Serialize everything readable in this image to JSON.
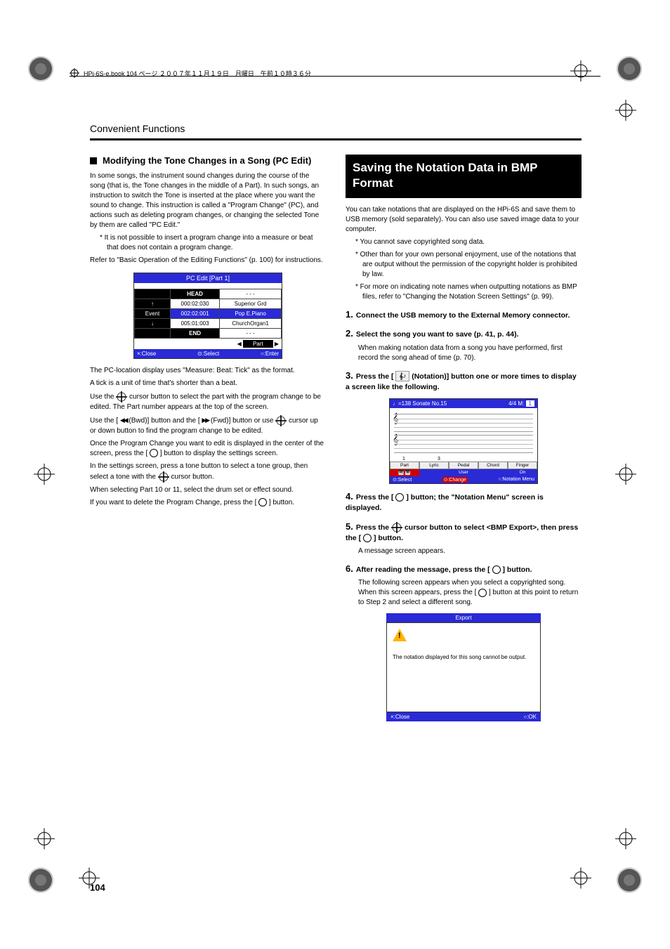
{
  "header_stamp": "HPi-6S-e.book  104 ページ  ２００７年１１月１９日　月曜日　午前１０時３６分",
  "running_head": "Convenient Functions",
  "left": {
    "title": "Modifying the Tone Changes in a Song (PC Edit)",
    "p1": "In some songs, the instrument sound changes during the course of the song (that is, the Tone changes in the middle of a Part). In such songs, an instruction to switch the Tone is inserted at the place where you want the sound to change. This instruction is called a \"Program Change\" (PC), and actions such as deleting program changes, or changing the selected Tone by them are called \"PC Edit.\"",
    "note1": "It is not possible to insert a program change into a measure or beat that does not contain a program change.",
    "p2": "Refer to \"Basic Operation of the Editing Functions\" (p. 100) for instructions.",
    "fig": {
      "title": "PC Edit [Part 1]",
      "head": "HEAD",
      "rows": [
        {
          "arrow": "↑",
          "loc": "000:02:030",
          "tone": "Superior Grd"
        },
        {
          "arrow": "Event",
          "loc": "002:02:001",
          "tone": "Pop E.Piano",
          "sel": true
        },
        {
          "arrow": "↓",
          "loc": "005:01:003",
          "tone": "ChurchOrgan1"
        }
      ],
      "end": "END",
      "partlabel": "Part",
      "close": "×:Close",
      "select": "⊙:Select",
      "enter": "○:Enter"
    },
    "p3": "The PC-location display uses \"Measure: Beat: Tick\" as the format.",
    "p4": "A tick is a unit of time that's shorter than a beat.",
    "p5a": "Use the ",
    "p5b": " cursor button to select the part with the program change to be edited. The Part number appears at the top of the screen.",
    "p6a": "Use the [ ",
    "p6b": " (Bwd)] button and the [ ",
    "p6c": " (Fwd)] button or use ",
    "p6d": " cursor up or down button to find the program change to be edited.",
    "p7": "Once the Program Change you want to edit is displayed in the center of the screen, press the [ ",
    "p7b": " ] button to display the settings screen.",
    "p8a": "In the settings screen, press a tone button to select a tone group, then select a tone with the ",
    "p8b": " cursor button.",
    "p9": "When selecting Part 10 or 11, select the drum set or effect sound.",
    "p10a": "If you want to delete the Program Change, press the [ ",
    "p10b": " ] button."
  },
  "right": {
    "heading": "Saving the Notation Data in BMP Format",
    "intro": "You can take notations that are displayed on the HPi-6S and save them to USB memory (sold separately). You can also use saved image data to your computer.",
    "bul1": "You cannot save copyrighted song data.",
    "bul2": "Other than for your own personal enjoyment, use of the notations that are output without the permission of the copyright holder is prohibited by law.",
    "bul3": "For more on indicating note names when outputting notations as BMP files, refer to \"Changing the Notation Screen Settings\" (p. 99).",
    "s1": "Connect the USB memory to the External Memory connector.",
    "s2h": "Select the song you want to save (p. 41, p. 44).",
    "s2b": "When making notation data from a song you have performed, first record the song ahead of time (p. 70).",
    "s3a": "Press the [ ",
    "s3b": " (Notation)] button one or more times to display a screen like the following.",
    "notation": {
      "top_left": "♩=138 Sonate No.15",
      "top_right_a": "4/4  M:",
      "top_right_b": "1",
      "tabs": [
        "Part",
        "Lyric",
        "Pedal",
        "Chord",
        "Finger"
      ],
      "subtabs": [
        "",
        "",
        "User",
        "",
        "On"
      ],
      "ft1": "⊙:Select",
      "ft2": "⊙:Change",
      "ft3": "○:Notation Menu"
    },
    "s4a": "Press the [ ",
    "s4b": " ] button; the \"Notation Menu\" screen is displayed.",
    "s5a": "Press the ",
    "s5b": " cursor button to select <BMP Export>, then press the [ ",
    "s5c": " ] button.",
    "s5body": "A message screen appears.",
    "s6a": "After reading the message, press the [ ",
    "s6b": " ] button.",
    "s6body1": "The following screen appears when you select a copyrighted song. When this screen appears, press the [ ",
    "s6body2": " ] button at this point to return to Step 2 and select a different song.",
    "export": {
      "title": "Export",
      "msg": "The notation displayed for this song cannot be output.",
      "close": "×:Close",
      "ok": "○:OK"
    }
  },
  "page_num": "104"
}
